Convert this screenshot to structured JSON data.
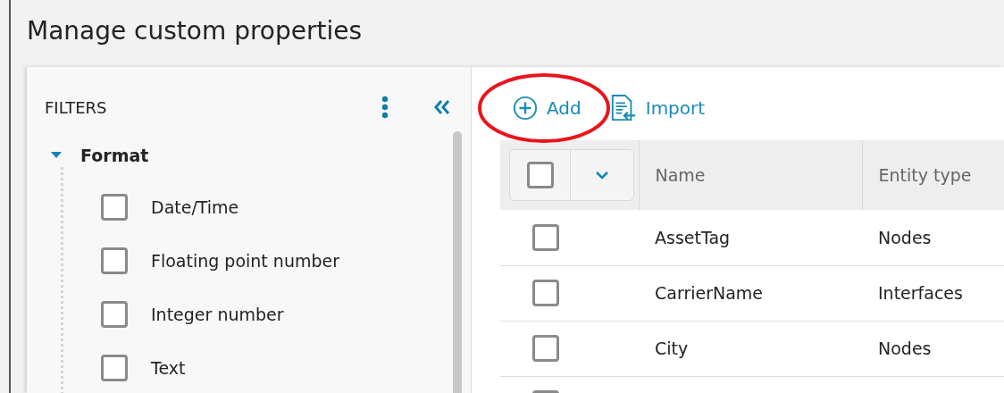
{
  "window": {
    "title": "Manage custom properties"
  },
  "filters": {
    "title": "FILTERS",
    "groups": [
      {
        "label": "Format",
        "expanded": true,
        "children": [
          {
            "label": "Date/Time",
            "checked": false
          },
          {
            "label": "Floating point number",
            "checked": false
          },
          {
            "label": "Integer number",
            "checked": false
          },
          {
            "label": "Text",
            "checked": false
          }
        ]
      }
    ]
  },
  "toolbar": [
    {
      "kind": "add",
      "label": "Add",
      "highlighted": true
    },
    {
      "kind": "import",
      "label": "Import",
      "highlighted": false
    }
  ],
  "table": {
    "select_all": {
      "checked": false
    },
    "columns": [
      "Name",
      "Entity type"
    ],
    "rows": [
      {
        "checked": false,
        "cells": [
          "AssetTag",
          "Nodes"
        ]
      },
      {
        "checked": false,
        "cells": [
          "CarrierName",
          "Interfaces"
        ]
      },
      {
        "checked": false,
        "cells": [
          "City",
          "Nodes"
        ]
      },
      {
        "checked": false,
        "cells": []
      }
    ]
  }
}
